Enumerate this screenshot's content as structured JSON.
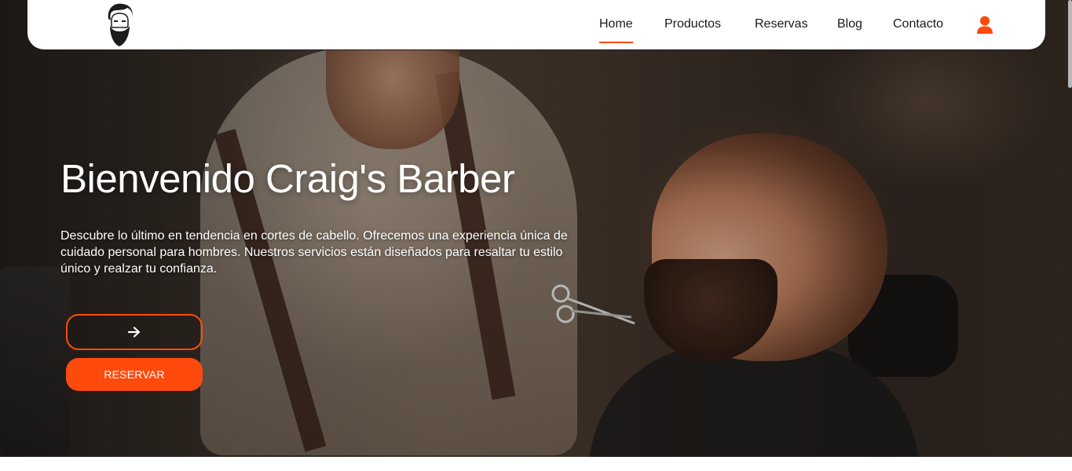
{
  "brand": {
    "logo": "bearded-man-logo-icon",
    "accent_color": "#ff4a0d"
  },
  "nav": {
    "items": [
      {
        "label": "Home",
        "active": true
      },
      {
        "label": "Productos",
        "active": false
      },
      {
        "label": "Reservas",
        "active": false
      },
      {
        "label": "Blog",
        "active": false
      },
      {
        "label": "Contacto",
        "active": false
      }
    ],
    "user_icon": "user-icon"
  },
  "hero": {
    "title": "Bienvenido Craig's Barber",
    "description": "Descubre lo último en tendencia en cortes de cabello. Ofrecemos una experiencia única de cuidado personal para hombres. Nuestros servicios están diseñados para resaltar tu estilo único y realzar tu confianza.",
    "arrow_button_icon": "arrow-right-icon",
    "reserve_label": "RESERVAR"
  }
}
